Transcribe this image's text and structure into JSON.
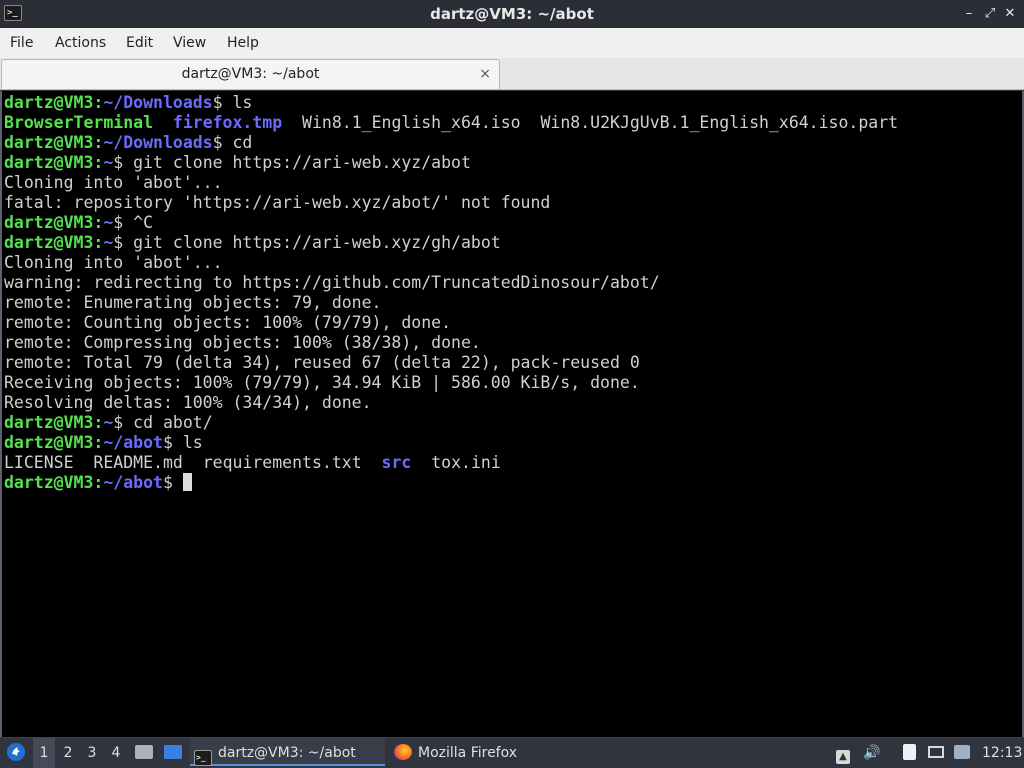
{
  "window": {
    "title": "dartz@VM3: ~/abot",
    "minimize": "–",
    "maximize": "⤢",
    "close": "✕"
  },
  "menubar": {
    "items": [
      "File",
      "Actions",
      "Edit",
      "View",
      "Help"
    ]
  },
  "tabs": [
    {
      "label": "dartz@VM3: ~/abot",
      "close": "×"
    }
  ],
  "terminal": {
    "prompt_user": "dartz@VM3",
    "prompt_sep": ":",
    "prompt_dollar": "$",
    "lines": [
      {
        "path": "~/Downloads",
        "cmd": " ls"
      },
      {
        "ls": [
          "BrowserTerminal",
          "firefox.tmp",
          "Win8.1_English_x64.iso",
          "Win8.U2KJgUvB.1_English_x64.iso.part"
        ]
      },
      {
        "path": "~/Downloads",
        "cmd": " cd"
      },
      {
        "path": "~",
        "cmd": " git clone https://ari-web.xyz/abot"
      },
      {
        "text": "Cloning into 'abot'..."
      },
      {
        "text": "fatal: repository 'https://ari-web.xyz/abot/' not found"
      },
      {
        "path": "~",
        "cmd": " ^C"
      },
      {
        "path": "~",
        "cmd": " git clone https://ari-web.xyz/gh/abot"
      },
      {
        "text": "Cloning into 'abot'..."
      },
      {
        "text": "warning: redirecting to https://github.com/TruncatedDinosour/abot/"
      },
      {
        "text": "remote: Enumerating objects: 79, done."
      },
      {
        "text": "remote: Counting objects: 100% (79/79), done."
      },
      {
        "text": "remote: Compressing objects: 100% (38/38), done."
      },
      {
        "text": "remote: Total 79 (delta 34), reused 67 (delta 22), pack-reused 0"
      },
      {
        "text": "Receiving objects: 100% (79/79), 34.94 KiB | 586.00 KiB/s, done."
      },
      {
        "text": "Resolving deltas: 100% (34/34), done."
      },
      {
        "path": "~",
        "cmd": " cd abot/"
      },
      {
        "path": "~/abot",
        "cmd": " ls"
      },
      {
        "ls": [
          "LICENSE",
          "README.md",
          "requirements.txt",
          "src",
          "tox.ini"
        ]
      },
      {
        "path": "~/abot",
        "cmd": " "
      }
    ]
  },
  "taskbar": {
    "workspaces": [
      "1",
      "2",
      "3",
      "4"
    ],
    "tasks": [
      {
        "label": "dartz@VM3: ~/abot",
        "icon": "terminal-icon"
      },
      {
        "label": "Mozilla Firefox",
        "icon": "firefox-icon"
      }
    ],
    "clock": "12:13"
  },
  "colors": {
    "prompt_green": "#54e34d",
    "path_blue": "#6b6bff",
    "terminal_bg": "#000000",
    "accent": "#5294e2"
  }
}
